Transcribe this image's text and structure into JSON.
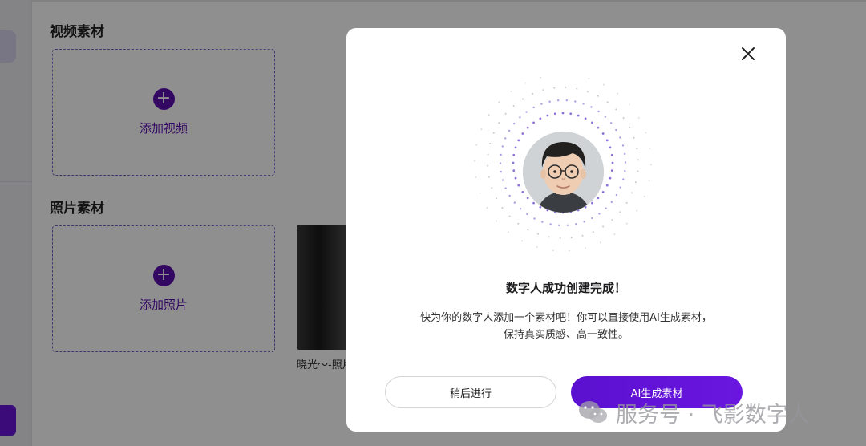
{
  "background": {
    "sections": [
      {
        "title": "视频素材",
        "upload_label": "添加视频"
      },
      {
        "title": "照片素材",
        "upload_label": "添加照片"
      }
    ],
    "photo_caption": "晓光～-照片"
  },
  "modal": {
    "title": "数字人成功创建完成！",
    "description_line1": "快为你的数字人添加一个素材吧！你可以直接使用AI生成素材，",
    "description_line2": "保持真实质感、高一致性。",
    "later_button": "稍后进行",
    "ai_button": "AI生成素材"
  },
  "watermark": "服务号 · 飞影数字人",
  "colors": {
    "accent": "#5a0fb0",
    "button_gradient_start": "#5b10cf",
    "button_gradient_end": "#6a16e0"
  },
  "icons": {
    "close": "close-icon",
    "add": "plus-circle-icon",
    "watermark": "wechat-logo"
  }
}
